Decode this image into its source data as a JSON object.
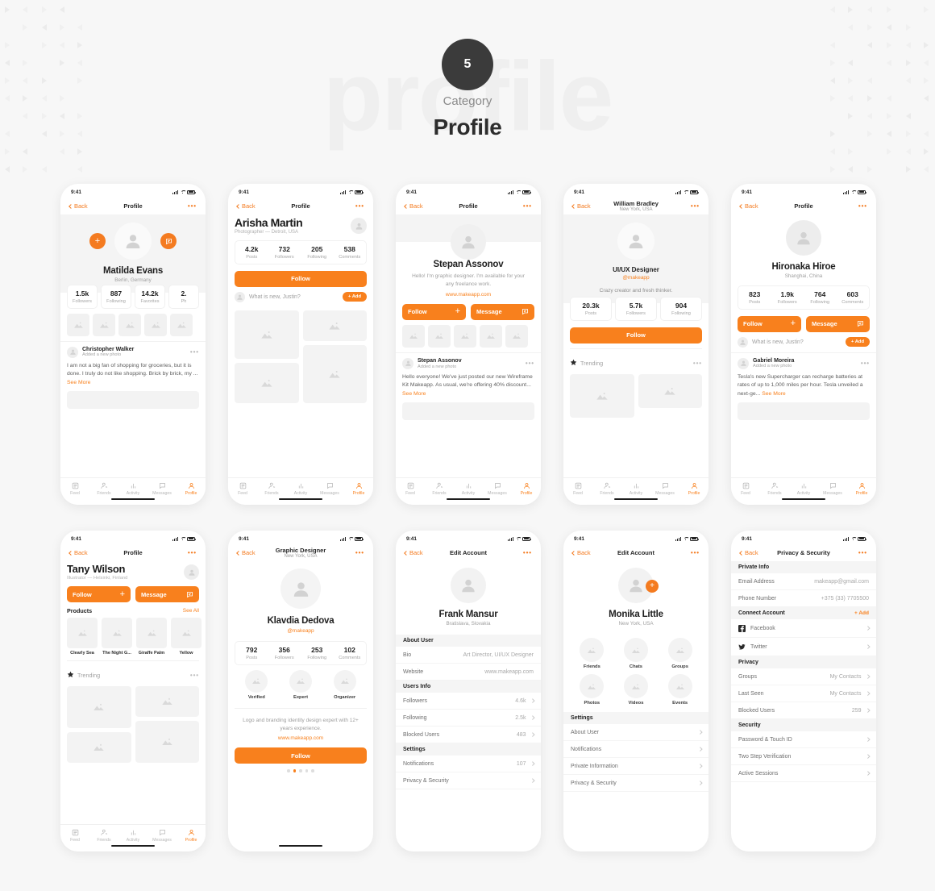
{
  "header": {
    "badge_number": "5",
    "category_label": "Category",
    "title": "Profile",
    "ghost_word": "profile"
  },
  "common": {
    "status_time": "9:41",
    "back_label": "Back",
    "dots": "•••",
    "tabs": [
      "Feed",
      "Friends",
      "Activity",
      "Messages",
      "Profile"
    ],
    "see_more": "See More",
    "added_photo": "Added a new photo",
    "follow": "Follow",
    "message": "Message",
    "add": "+ Add",
    "see_all": "See All",
    "whats_new": "What is new, Justin?",
    "trending": "Trending"
  },
  "screens": [
    {
      "id": "matilda",
      "nav_title": "Profile",
      "name": "Matilda Evans",
      "location": "Berlin, Germany",
      "stats": [
        {
          "value": "1.5k",
          "label": "Followers"
        },
        {
          "value": "887",
          "label": "Following"
        },
        {
          "value": "14.2k",
          "label": "Favorites"
        },
        {
          "value": "2.",
          "label": "Ph"
        }
      ],
      "post": {
        "author": "Christopher Walker",
        "subtitle": "Added a new photo",
        "text": "I am not a big fan of shopping for groceries, but it is done. I truly do not like shopping. Brick by brick, my ... "
      }
    },
    {
      "id": "arisha",
      "nav_title": "Profile",
      "name": "Arisha Martin",
      "location": "Photographer — Detroit, USA",
      "stats": [
        {
          "value": "4.2k",
          "label": "Posts"
        },
        {
          "value": "732",
          "label": "Followers"
        },
        {
          "value": "205",
          "label": "Following"
        },
        {
          "value": "538",
          "label": "Comments"
        }
      ],
      "follow_label": "Follow",
      "composer": "What is new, Justin?",
      "add_label": "+ Add"
    },
    {
      "id": "stepan",
      "nav_title": "Profile",
      "name": "Stepan Assonov",
      "bio": "Hello! I'm graphic designer. I'm available for your any freelance work.",
      "website": "www.makeapp.com",
      "follow_label": "Follow",
      "message_label": "Message",
      "post": {
        "author": "Stepan Assonov",
        "subtitle": "Added a new photo",
        "text": "Hello everyone! We've just posted our new Wireframe Kit Makeapp. As usual, we're offering 40% discount... "
      }
    },
    {
      "id": "william",
      "nav_title": "William Bradley",
      "nav_subtitle": "New York, USA",
      "role": "UI/UX Designer",
      "handle": "@makeapp",
      "bio": "Crazy creator and fresh thinker.",
      "stats": [
        {
          "value": "20.3k",
          "label": "Posts"
        },
        {
          "value": "5.7k",
          "label": "Followers"
        },
        {
          "value": "904",
          "label": "Following"
        }
      ],
      "follow_label": "Follow",
      "section": "Trending"
    },
    {
      "id": "hironaka",
      "nav_title": "Profile",
      "name": "Hironaka Hiroe",
      "location": "Shanghai, China",
      "stats": [
        {
          "value": "823",
          "label": "Posts"
        },
        {
          "value": "1.9k",
          "label": "Followers"
        },
        {
          "value": "764",
          "label": "Following"
        },
        {
          "value": "603",
          "label": "Comments"
        }
      ],
      "follow_label": "Follow",
      "message_label": "Message",
      "composer": "What is new, Justin?",
      "add_label": "+ Add",
      "post": {
        "author": "Gabriel Moreira",
        "subtitle": "Added a new photo",
        "text": "Tesla's new Supercharger can recharge batteries at rates of up to 1,000 miles per hour. Tesla unveiled a next-ge... "
      }
    },
    {
      "id": "tany",
      "nav_title": "Profile",
      "name": "Tany Wilson",
      "location": "Illustrator — Helsinki, Finland",
      "follow_label": "Follow",
      "message_label": "Message",
      "products_title": "Products",
      "see_all": "See All",
      "products": [
        "Clearly Sea",
        "The Night G...",
        "Giraffe Palm",
        "Yellow"
      ],
      "trending_title": "Trending"
    },
    {
      "id": "klavdia",
      "nav_title": "Graphic Designer",
      "nav_subtitle": "New York, USA",
      "name": "Klavdia Dedova",
      "handle": "@makeapp",
      "stats": [
        {
          "value": "792",
          "label": "Posts"
        },
        {
          "value": "356",
          "label": "Followers"
        },
        {
          "value": "253",
          "label": "Following"
        },
        {
          "value": "102",
          "label": "Comments"
        }
      ],
      "badges": [
        "Verified",
        "Expert",
        "Organizer"
      ],
      "bio": "Logo and branding identity design expert with 12+ years experience.",
      "website": "www.makeapp.com",
      "follow_label": "Follow",
      "pager_active": 1,
      "pager_count": 5
    },
    {
      "id": "frank",
      "nav_title": "Edit Account",
      "name": "Frank Mansur",
      "location": "Bratislava, Slovakia",
      "sections": [
        {
          "title": "About User",
          "rows": [
            {
              "label": "Bio",
              "value": "Art Director, UI/UX Designer",
              "chevron": false
            },
            {
              "label": "Website",
              "value": "www.makeapp.com",
              "chevron": false
            }
          ]
        },
        {
          "title": "Users Info",
          "rows": [
            {
              "label": "Followers",
              "value": "4.6k",
              "chevron": true
            },
            {
              "label": "Following",
              "value": "2.5k",
              "chevron": true
            },
            {
              "label": "Blocked Users",
              "value": "483",
              "chevron": true
            }
          ]
        },
        {
          "title": "Settings",
          "rows": [
            {
              "label": "Notifications",
              "value": "107",
              "chevron": true
            },
            {
              "label": "Privacy & Security",
              "value": "",
              "chevron": true
            }
          ]
        }
      ]
    },
    {
      "id": "monika",
      "nav_title": "Edit Account",
      "name": "Monika Little",
      "location": "New York, USA",
      "tiles": [
        "Friends",
        "Chats",
        "Groups",
        "Photos",
        "Videos",
        "Events"
      ],
      "sections": [
        {
          "title": "Settings",
          "rows": [
            {
              "label": "About User",
              "value": "",
              "chevron": true
            },
            {
              "label": "Notifications",
              "value": "",
              "chevron": true
            },
            {
              "label": "Private Information",
              "value": "",
              "chevron": true
            },
            {
              "label": "Privacy & Security",
              "value": "",
              "chevron": true
            }
          ]
        }
      ]
    },
    {
      "id": "privacy",
      "nav_title": "Privacy & Security",
      "sections": [
        {
          "title": "Private Info",
          "rows": [
            {
              "label": "Email Address",
              "value": "makeapp@gmail.com",
              "chevron": false
            },
            {
              "label": "Phone Number",
              "value": "+375 (33) 7705500",
              "chevron": false
            }
          ]
        },
        {
          "title": "Connect Account",
          "action": "+ Add",
          "rows": [
            {
              "label": "Facebook",
              "value": "",
              "chevron": true,
              "icon": "facebook-icon"
            },
            {
              "label": "Twitter",
              "value": "",
              "chevron": true,
              "icon": "twitter-icon"
            }
          ]
        },
        {
          "title": "Privacy",
          "rows": [
            {
              "label": "Groups",
              "value": "My Contacts",
              "chevron": true
            },
            {
              "label": "Last Seen",
              "value": "My Contacts",
              "chevron": true
            },
            {
              "label": "Blocked Users",
              "value": "259",
              "chevron": true
            }
          ]
        },
        {
          "title": "Security",
          "rows": [
            {
              "label": "Password & Touch ID",
              "value": "",
              "chevron": true
            },
            {
              "label": "Two Step Verification",
              "value": "",
              "chevron": true
            },
            {
              "label": "Active Sessions",
              "value": "",
              "chevron": true
            }
          ]
        }
      ]
    }
  ],
  "colors": {
    "accent": "#f8801d",
    "page_bg": "#f7f7f7",
    "text_dark": "#1f1f1f",
    "text_muted": "#a0a0a0"
  }
}
